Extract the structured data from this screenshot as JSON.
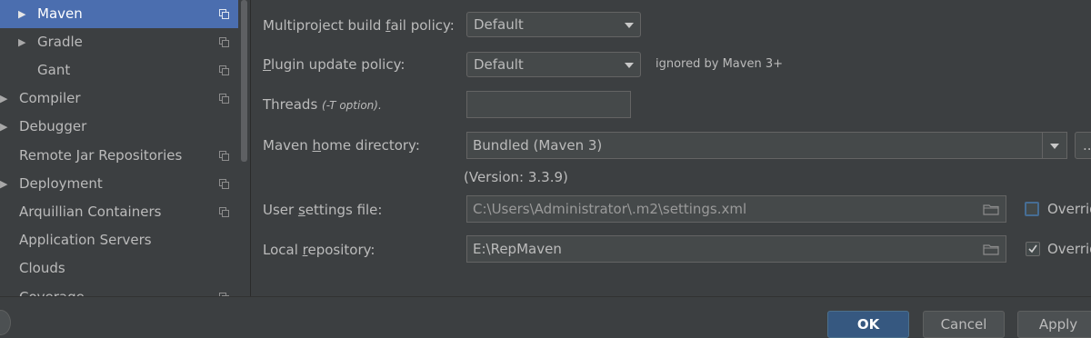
{
  "sidebar": {
    "items": [
      {
        "label": "Maven",
        "expandable": true,
        "selected": true,
        "has_copy_icon": true
      },
      {
        "label": "Gradle",
        "expandable": true,
        "selected": false,
        "has_copy_icon": true
      },
      {
        "label": "Gant",
        "expandable": false,
        "selected": false,
        "has_copy_icon": true
      },
      {
        "label": "Compiler",
        "expandable": true,
        "selected": false,
        "has_copy_icon": true
      },
      {
        "label": "Debugger",
        "expandable": true,
        "selected": false,
        "has_copy_icon": false
      },
      {
        "label": "Remote Jar Repositories",
        "expandable": false,
        "selected": false,
        "has_copy_icon": true
      },
      {
        "label": "Deployment",
        "expandable": true,
        "selected": false,
        "has_copy_icon": true
      },
      {
        "label": "Arquillian Containers",
        "expandable": false,
        "selected": false,
        "has_copy_icon": true
      },
      {
        "label": "Application Servers",
        "expandable": false,
        "selected": false,
        "has_copy_icon": false
      },
      {
        "label": "Clouds",
        "expandable": false,
        "selected": false,
        "has_copy_icon": false
      },
      {
        "label": "Coverage",
        "expandable": false,
        "selected": false,
        "has_copy_icon": true
      }
    ]
  },
  "form": {
    "fail_policy": {
      "label_pre": "Multiproject build ",
      "label_mnemonic": "f",
      "label_post": "ail policy:",
      "value": "Default"
    },
    "plugin_policy": {
      "label_pre": "",
      "label_mnemonic": "P",
      "label_post": "lugin update policy:",
      "value": "Default",
      "hint": "ignored by Maven 3+"
    },
    "threads": {
      "label": "Threads",
      "label_hint": "(-T option).",
      "value": ""
    },
    "maven_home": {
      "label_pre": "Maven ",
      "label_mnemonic": "h",
      "label_post": "ome directory:",
      "value": "Bundled (Maven 3)",
      "browse_label": "...",
      "version": "(Version: 3.3.9)"
    },
    "user_settings": {
      "label_pre": "User ",
      "label_mnemonic": "s",
      "label_post": "ettings file:",
      "value": "C:\\Users\\Administrator\\.m2\\settings.xml",
      "override_label": "Override",
      "override_checked": false
    },
    "local_repo": {
      "label_pre": "Local ",
      "label_mnemonic": "r",
      "label_post": "epository:",
      "value": "E:\\RepMaven",
      "override_label": "Override",
      "override_checked": true
    }
  },
  "footer": {
    "ok_label": "OK",
    "cancel_label": "Cancel",
    "apply_label": "Apply"
  },
  "icons": {
    "copy": "copy-icon",
    "folder": "folder-icon",
    "dropdown": "chevron-down-icon",
    "expand": "triangle-right-icon"
  },
  "colors": {
    "selection": "#4b6eaf",
    "background": "#3c3f41",
    "field": "#45494a",
    "primary_button": "#365880"
  }
}
